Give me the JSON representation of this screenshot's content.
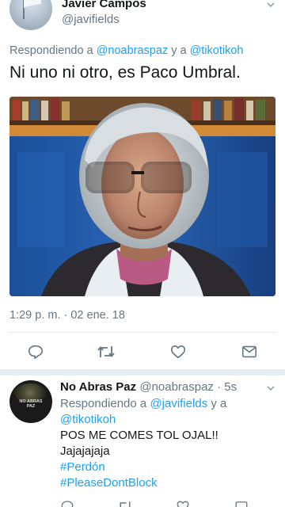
{
  "main_tweet": {
    "author_name": "Javier Campos",
    "author_handle": "@javifields",
    "replying_prefix": "Respondiendo a",
    "replying_user_1": "@noabraspaz",
    "replying_joiner": "y a",
    "replying_user_2": "@tikotikoh",
    "text": "Ni uno ni otro, es Paco Umbral.",
    "timestamp": "1:29 p. m. · 02 ene. 18",
    "actions": [
      "reply-icon",
      "retweet-icon",
      "like-icon",
      "message-icon"
    ]
  },
  "second_tweet": {
    "avatar_text": "NO ABRAS PAZ",
    "author_name": "No Abras Paz",
    "author_handle": "@noabraspaz",
    "time": "· 5s",
    "replying_prefix": "Respondiendo a",
    "replying_user_1": "@javifields",
    "replying_joiner": "y a",
    "replying_user_2": "@tikotikoh",
    "line_1": "POS ME COMES TOL OJAL!!",
    "line_2": "Jajajajaja",
    "hashtag_1": "#Perdón",
    "hashtag_2": "#PleaseDontBlock"
  },
  "colors": {
    "link": "#1da1f2",
    "secondary_text": "#657786",
    "primary_text": "#14171a",
    "divider": "#e6ecf0"
  }
}
